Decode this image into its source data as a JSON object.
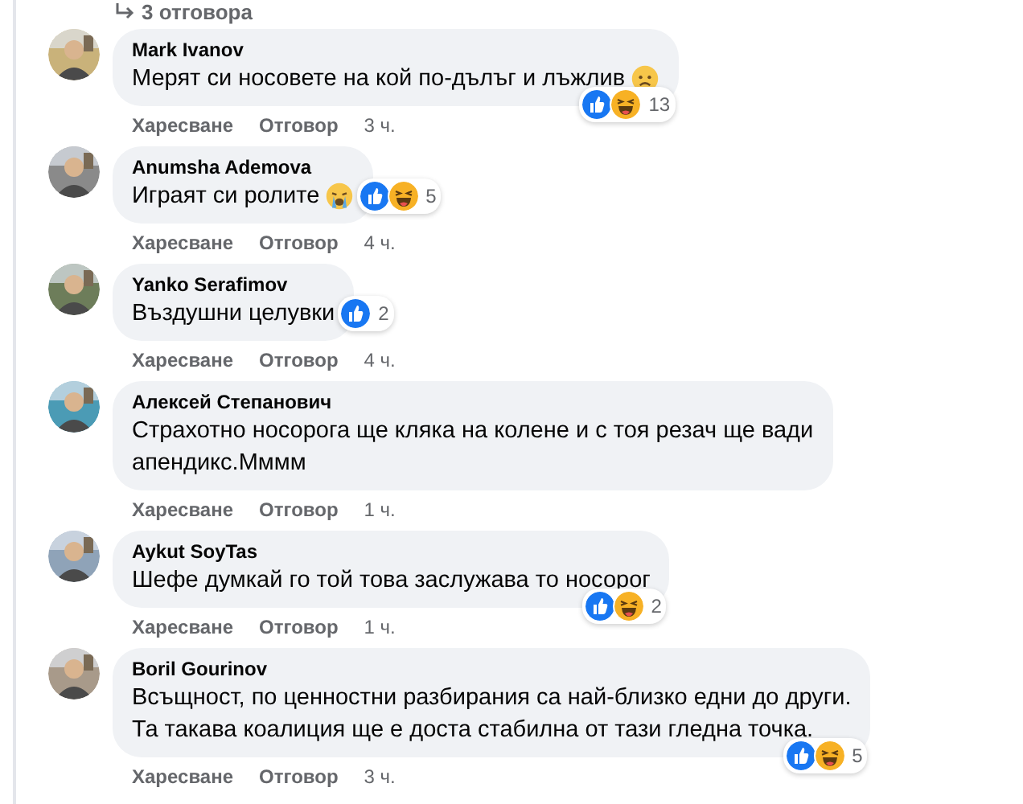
{
  "replies_link": {
    "label": "3 отговора"
  },
  "comments": [
    {
      "author": "Mark Ivanov",
      "lines": [
        "Мерят си носовете на кой по-дълъг и лъжлив"
      ],
      "emoji": {
        "kind": "worried"
      },
      "reactions": {
        "icons": [
          {
            "kind": "like"
          },
          {
            "kind": "haha"
          }
        ],
        "count": "13"
      },
      "actions": [
        "Харесване",
        "Отговор"
      ],
      "time": "3 ч."
    },
    {
      "author": "Anumsha Ademova",
      "lines": [
        "Играят си ролите"
      ],
      "emoji": {
        "kind": "crying"
      },
      "reactions": {
        "icons": [
          {
            "kind": "like"
          },
          {
            "kind": "haha"
          }
        ],
        "count": "5"
      },
      "actions": [
        "Харесване",
        "Отговор"
      ],
      "time": "4 ч."
    },
    {
      "author": "Yanko Serafimov",
      "lines": [
        "Въздушни целувки"
      ],
      "reactions": {
        "icons": [
          {
            "kind": "like"
          }
        ],
        "count": "2"
      },
      "actions": [
        "Харесване",
        "Отговор"
      ],
      "time": "4 ч."
    },
    {
      "author": "Алексей Степанович",
      "lines": [
        "Страхотно носорога ще кляка на колене и с тоя резач ще вади",
        "апендикс.Мммм"
      ],
      "actions": [
        "Харесване",
        "Отговор"
      ],
      "time": "1 ч."
    },
    {
      "author": "Aykut SoyTas",
      "lines": [
        "Шефе думкай го той това заслужава то носорог"
      ],
      "reactions": {
        "icons": [
          {
            "kind": "like"
          },
          {
            "kind": "haha"
          }
        ],
        "count": "2"
      },
      "actions": [
        "Харесване",
        "Отговор"
      ],
      "time": "1 ч."
    },
    {
      "author": "Boril Gourinov",
      "lines": [
        "Всъщност, по ценностни разбирания са най-близко едни до други.",
        "Та такава коалиция ще е доста стабилна от тази гледна точка."
      ],
      "reactions": {
        "icons": [
          {
            "kind": "like"
          },
          {
            "kind": "haha"
          }
        ],
        "count": "5"
      },
      "actions": [
        "Харесване",
        "Отговор"
      ],
      "time": "3 ч."
    }
  ]
}
